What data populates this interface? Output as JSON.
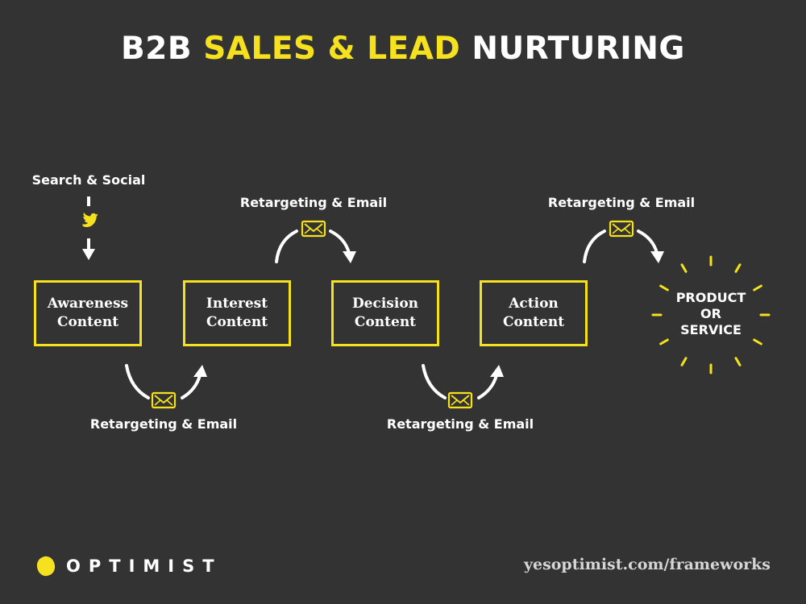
{
  "title": {
    "part1": "B2B ",
    "highlight": "SALES & LEAD",
    "part2": " NURTURING"
  },
  "colors": {
    "background": "#333333",
    "accent": "#f5e11e",
    "text": "#ffffff"
  },
  "entry": {
    "label": "Search & Social",
    "icon": "twitter-bird-icon"
  },
  "stages": [
    {
      "line1": "Awareness",
      "line2": "Content"
    },
    {
      "line1": "Interest",
      "line2": "Content"
    },
    {
      "line1": "Decision",
      "line2": "Content"
    },
    {
      "line1": "Action",
      "line2": "Content"
    }
  ],
  "transitions": [
    {
      "label": "Retargeting & Email",
      "icon": "envelope-icon",
      "position": "below",
      "from": "Awareness Content",
      "to": "Interest Content"
    },
    {
      "label": "Retargeting & Email",
      "icon": "envelope-icon",
      "position": "above",
      "from": "Interest Content",
      "to": "Decision Content"
    },
    {
      "label": "Retargeting & Email",
      "icon": "envelope-icon",
      "position": "below",
      "from": "Decision Content",
      "to": "Action Content"
    },
    {
      "label": "Retargeting & Email",
      "icon": "envelope-icon",
      "position": "above",
      "from": "Action Content",
      "to": "Product or Service"
    }
  ],
  "goal": {
    "line1": "PRODUCT",
    "line2": "OR",
    "line3": "SERVICE"
  },
  "footer": {
    "brand": "OPTIMIST",
    "url": "yesoptimist.com/frameworks"
  }
}
